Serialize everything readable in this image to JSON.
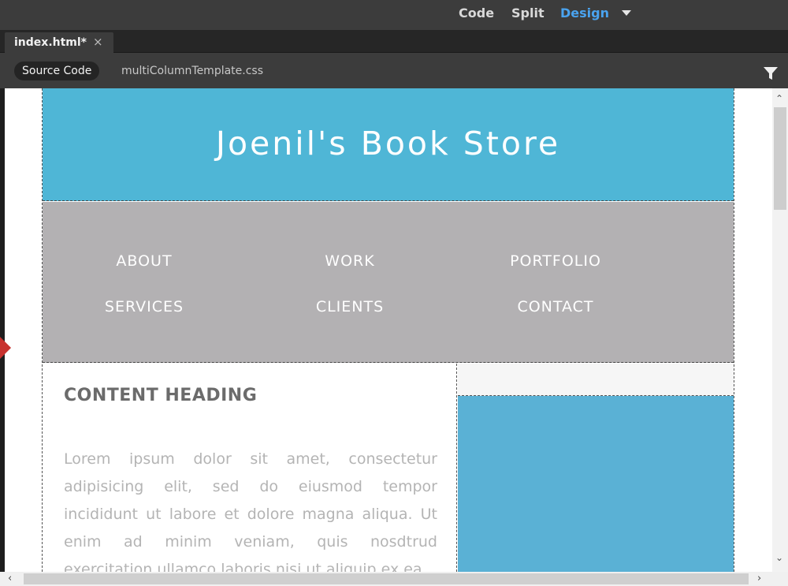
{
  "view_switcher": {
    "code": "Code",
    "split": "Split",
    "design": "Design",
    "active": "Design",
    "active_color": "#4aa3ef",
    "dropdown_icon": "caret-down-icon"
  },
  "document_tab": {
    "title": "index.html*",
    "close": "×"
  },
  "related_files": {
    "source_code": "Source Code",
    "css_file": "multiColumnTemplate.css",
    "filter_icon": "filter-icon"
  },
  "page": {
    "header": {
      "title": "Joenil's Book Store",
      "background": "#4fb6d6"
    },
    "nav": {
      "background": "#b3b1b3",
      "links": [
        "ABOUT",
        "WORK",
        "PORTFOLIO",
        "SERVICES",
        "CLIENTS",
        "CONTACT"
      ]
    },
    "content": {
      "heading": "CONTENT HEADING",
      "body": "Lorem ipsum dolor sit amet, consectetur adipisicing elit, sed do eiusmod tempor incididunt ut labore et dolore magna aliqua. Ut enim ad minim veniam, quis nosdtrud exercitation ullamco laboris nisi ut aliquip ex ea"
    },
    "aside": {
      "box_color": "#5ab1d5"
    }
  },
  "scrollbars": {
    "up": "⌃",
    "down": "⌄",
    "left": "‹",
    "right": "›"
  }
}
